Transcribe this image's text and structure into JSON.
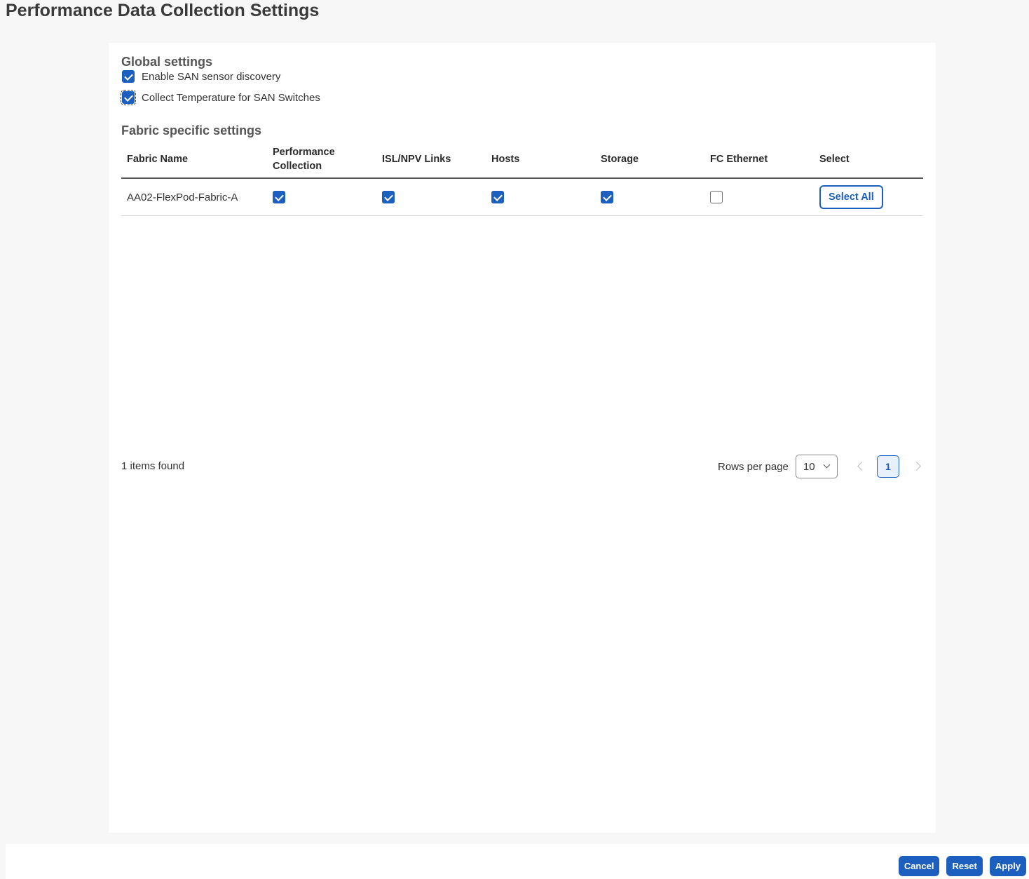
{
  "page": {
    "title": "Performance Data Collection Settings"
  },
  "global_settings": {
    "title": "Global settings",
    "enable_san_sensor_discovery": {
      "label": "Enable SAN sensor discovery",
      "checked": true
    },
    "collect_temperature": {
      "label": "Collect Temperature for SAN Switches",
      "checked": true
    }
  },
  "fabric_settings": {
    "title": "Fabric specific settings",
    "columns": [
      "Fabric Name",
      "Performance Collection",
      "ISL/NPV Links",
      "Hosts",
      "Storage",
      "FC Ethernet",
      "Select"
    ],
    "rows": [
      {
        "fabric_name": "AA02-FlexPod-Fabric-A",
        "performance_collection": true,
        "isl_npv_links": true,
        "hosts": true,
        "storage": true,
        "fc_ethernet": false,
        "select_label": "Select All"
      }
    ]
  },
  "pagination": {
    "items_found": "1 items found",
    "rows_per_page_label": "Rows per page",
    "rows_per_page_value": "10",
    "current_page": "1"
  },
  "footer": {
    "cancel_label": "Cancel",
    "reset_label": "Reset",
    "apply_label": "Apply"
  },
  "colors": {
    "accent": "#1d5fbf",
    "background": "#f7f7f7",
    "panel": "#ffffff"
  }
}
